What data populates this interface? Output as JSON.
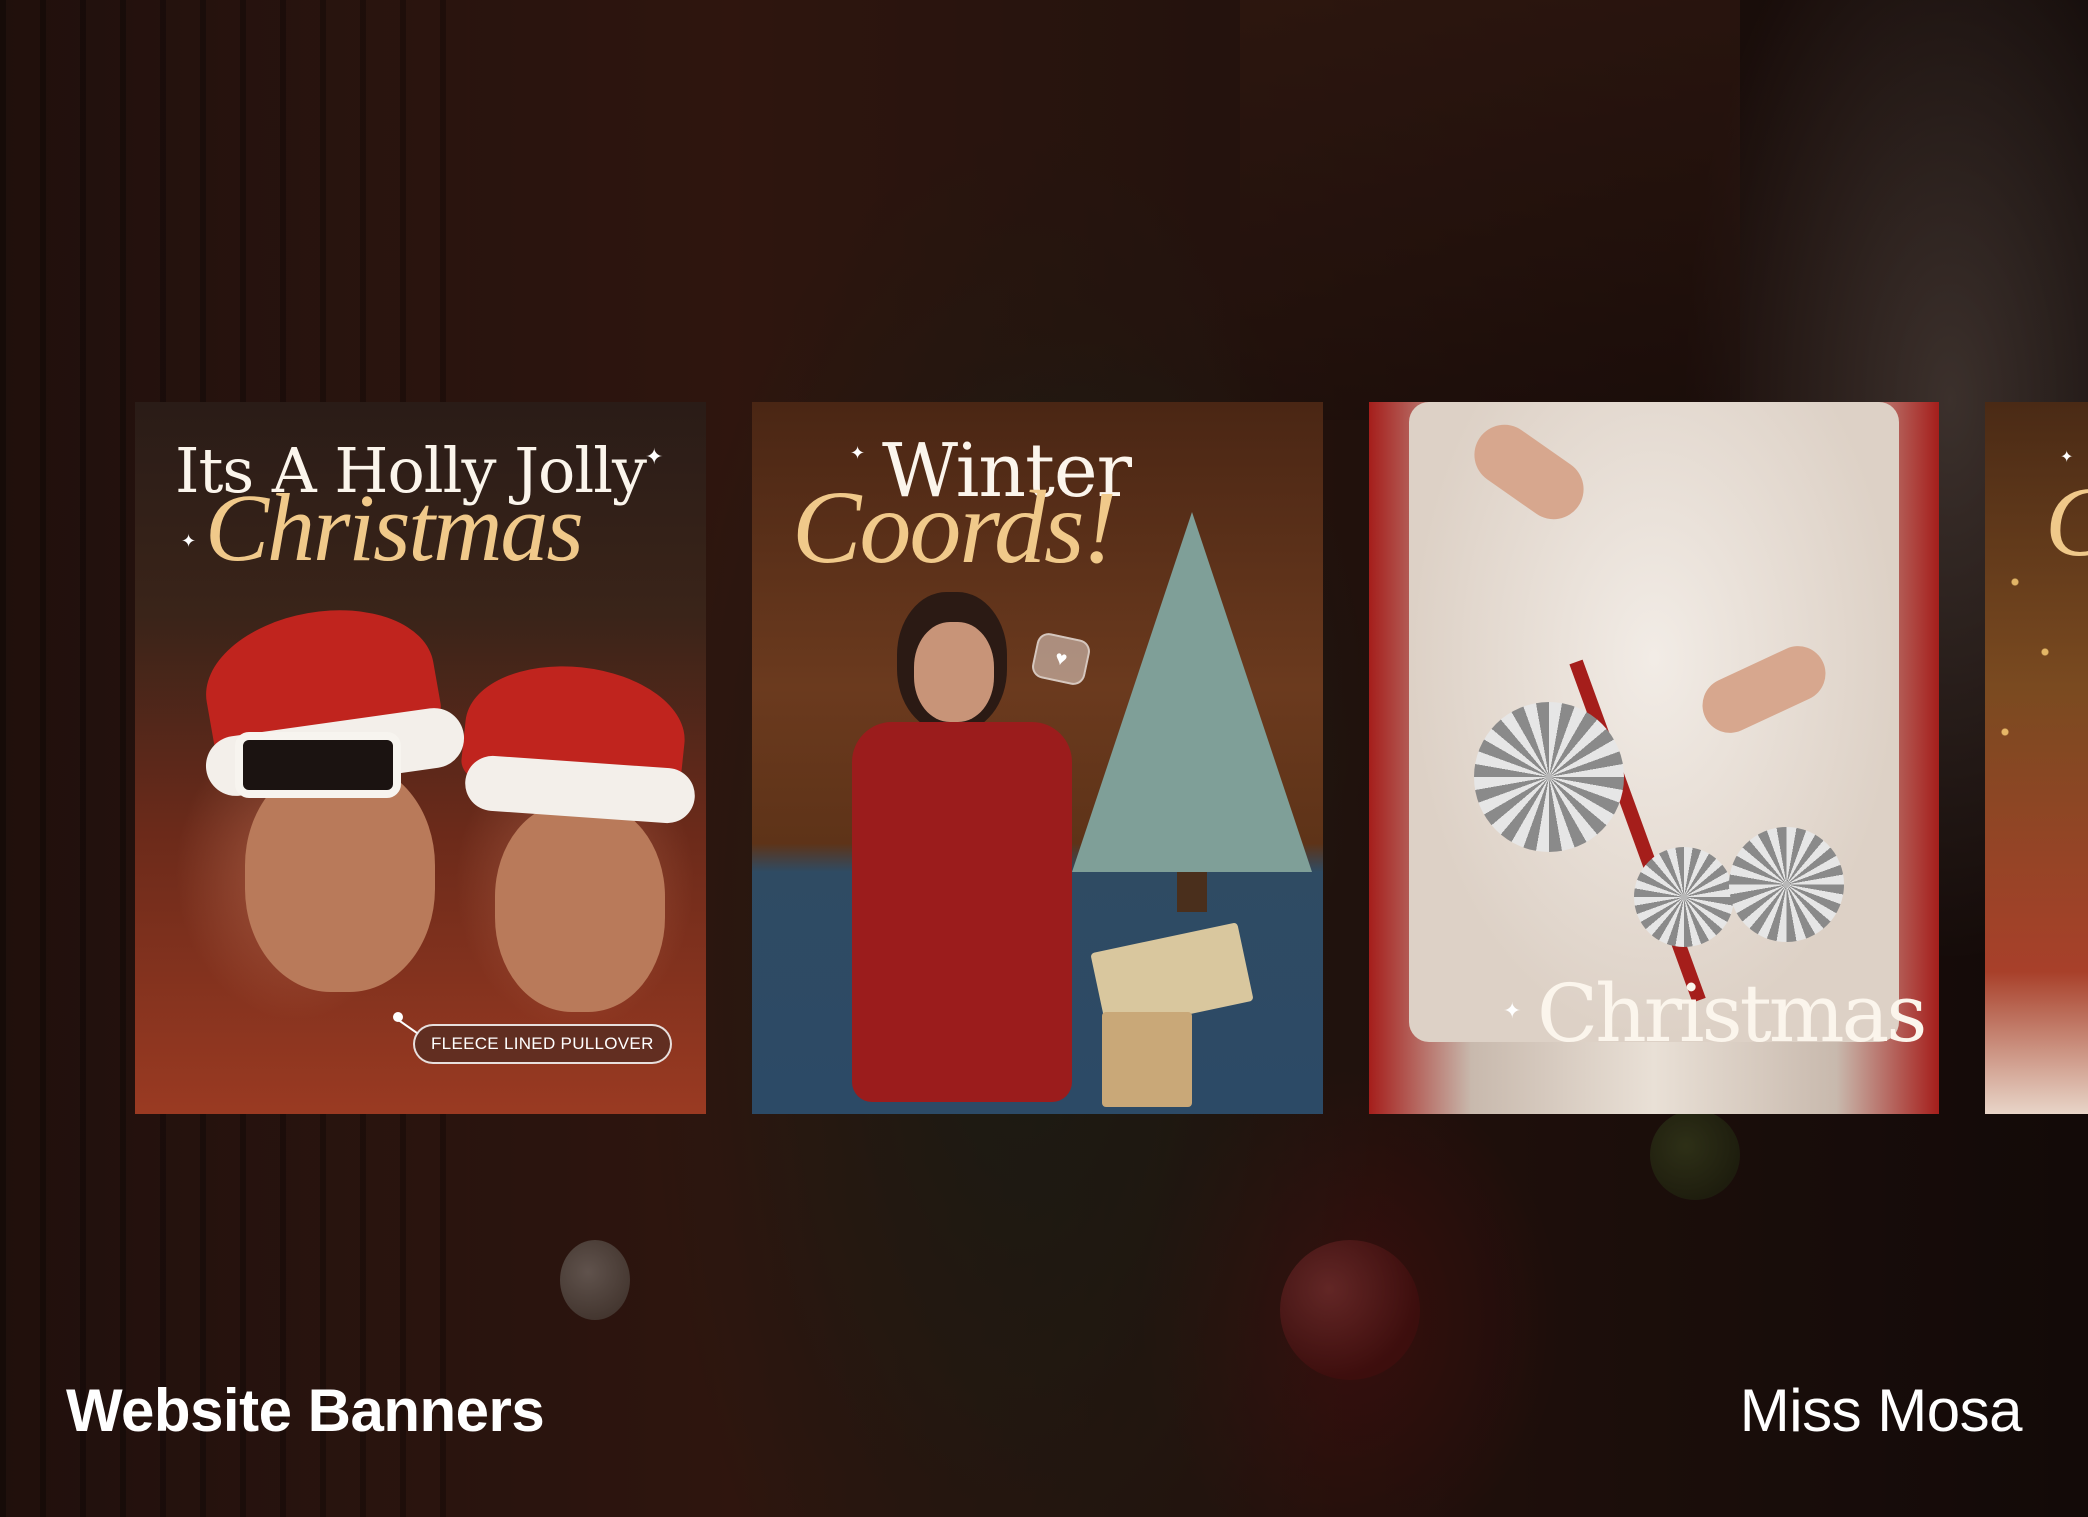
{
  "gallery": {
    "cards": [
      {
        "headline_line1": "Its A Holly Jolly",
        "headline_line2": "Christmas",
        "product_tag": "FLEECE LINED PULLOVER"
      },
      {
        "headline_line1": "Winter",
        "headline_line2": "Coords!",
        "heart_glyph": "♥"
      },
      {
        "headline": "Christmas"
      },
      {
        "headline_partial": "C"
      }
    ],
    "sparkle_glyph": "✦"
  },
  "footer": {
    "section_title": "Website Banners",
    "client_name": "Miss Mosa"
  },
  "colors": {
    "headline_script": "#f0c98a",
    "headline_serif": "#fbf5ec",
    "accent_red": "#a51e1b"
  }
}
